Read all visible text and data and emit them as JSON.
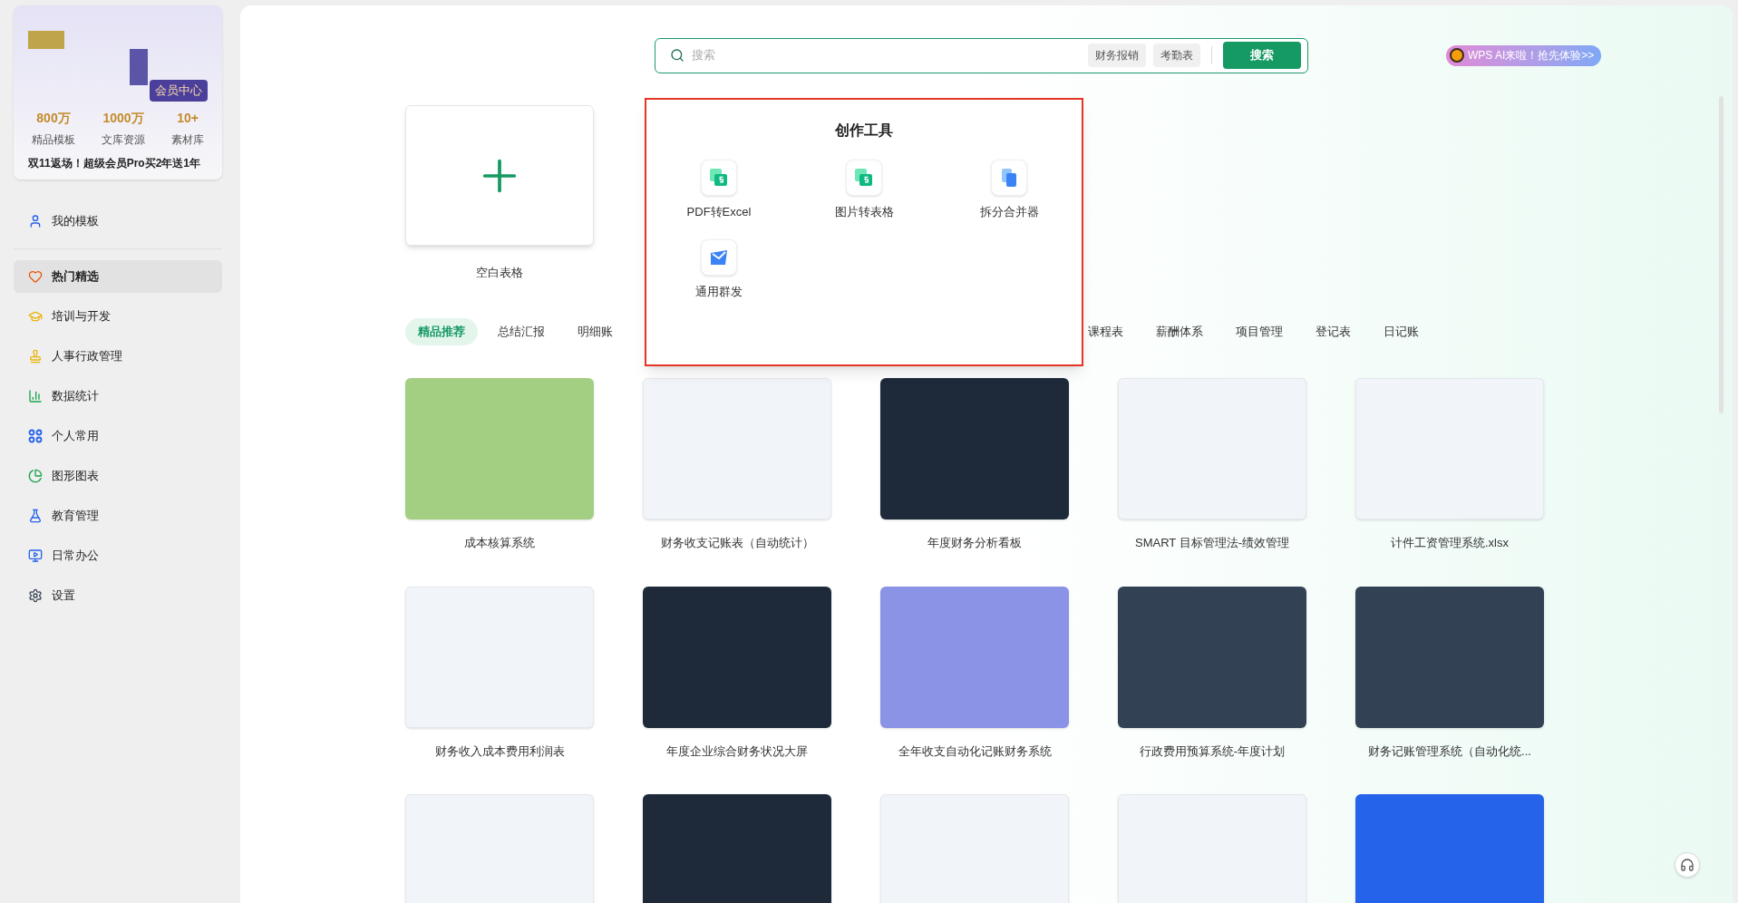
{
  "profile": {
    "member_button": "会员中心",
    "stats": [
      {
        "value": "800万",
        "label": "精品模板"
      },
      {
        "value": "1000万",
        "label": "文库资源"
      },
      {
        "value": "10+",
        "label": "素材库"
      }
    ],
    "promo": "双11返场！超级会员Pro买2年送1年"
  },
  "sidebar": {
    "top_item": {
      "label": "我的模板"
    },
    "items": [
      {
        "label": "热门精选",
        "selected": true
      },
      {
        "label": "培训与开发",
        "selected": false
      },
      {
        "label": "人事行政管理",
        "selected": false
      },
      {
        "label": "数据统计",
        "selected": false
      },
      {
        "label": "个人常用",
        "selected": false
      },
      {
        "label": "图形图表",
        "selected": false
      },
      {
        "label": "教育管理",
        "selected": false
      },
      {
        "label": "日常办公",
        "selected": false
      },
      {
        "label": "设置",
        "selected": false
      }
    ]
  },
  "search": {
    "placeholder": "搜索",
    "chips": [
      "财务报销",
      "考勤表"
    ],
    "button": "搜索"
  },
  "ai_badge": "WPS AI来啦！抢先体验>>",
  "blank_card": {
    "label": "空白表格"
  },
  "tools_popup": {
    "title": "创作工具",
    "tools": [
      {
        "label": "PDF转Excel",
        "kind": "sheet"
      },
      {
        "label": "图片转表格",
        "kind": "sheet"
      },
      {
        "label": "拆分合并器",
        "kind": "split"
      },
      {
        "label": "通用群发",
        "kind": "mail"
      }
    ]
  },
  "tabs": [
    {
      "label": "精品推荐",
      "selected": true
    },
    {
      "label": "总结汇报",
      "selected": false
    },
    {
      "label": "明细账",
      "selected": false
    },
    {
      "label": "课程表",
      "selected": false
    },
    {
      "label": "薪酬体系",
      "selected": false
    },
    {
      "label": "项目管理",
      "selected": false
    },
    {
      "label": "登记表",
      "selected": false
    },
    {
      "label": "日记账",
      "selected": false
    }
  ],
  "templates": [
    {
      "title": "成本核算系统",
      "kind": "green"
    },
    {
      "title": "财务收支记账表（自动统计）",
      "kind": "light"
    },
    {
      "title": "年度财务分析看板",
      "kind": "dark"
    },
    {
      "title": "SMART 目标管理法-绩效管理",
      "kind": "light"
    },
    {
      "title": "计件工资管理系统.xlsx",
      "kind": "light"
    },
    {
      "title": "财务收入成本费用利润表",
      "kind": "light"
    },
    {
      "title": "年度企业综合财务状况大屏",
      "kind": "dark"
    },
    {
      "title": "全年收支自动化记账财务系统",
      "kind": "purple"
    },
    {
      "title": "行政费用预算系统-年度计划",
      "kind": "slate"
    },
    {
      "title": "财务记账管理系统（自动化统...",
      "kind": "slate"
    },
    {
      "kind": "light"
    },
    {
      "kind": "dark"
    },
    {
      "kind": "light"
    },
    {
      "kind": "light"
    },
    {
      "kind": "blue"
    }
  ]
}
